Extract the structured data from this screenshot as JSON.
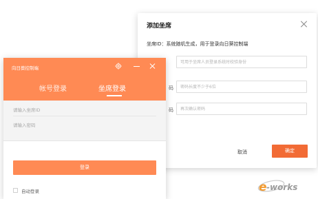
{
  "dialog": {
    "title": "添加坐席",
    "seat_id_line": "坐席ID：系统随机生成，用于登录向日葵控制端",
    "fields": [
      {
        "label": "",
        "placeholder": "可用于坐席人员登录系统时校验身份"
      },
      {
        "label": "码",
        "placeholder": "密码长度不少于6位"
      },
      {
        "label": "码",
        "placeholder": "再次确认密码"
      }
    ],
    "cancel_label": "取消",
    "confirm_label": "确定"
  },
  "login": {
    "window_title": "向日葵控制端",
    "tabs": [
      "帐号登录",
      "坐席登录"
    ],
    "active_tab": "坐席登录",
    "seat_id_placeholder": "请输入坐席ID",
    "password_placeholder": "请输入密码",
    "login_button": "登录",
    "auto_login_label": "自动登录"
  },
  "watermark": {
    "text": "e-works"
  },
  "colors": {
    "accent": "#ff8a54",
    "confirm": "#f26b35",
    "watermark_orange": "#f29a2e",
    "watermark_gray": "#9a9a9a"
  },
  "icons": [
    "gear-icon",
    "minimize-icon",
    "close-icon",
    "dialog-close-icon"
  ]
}
